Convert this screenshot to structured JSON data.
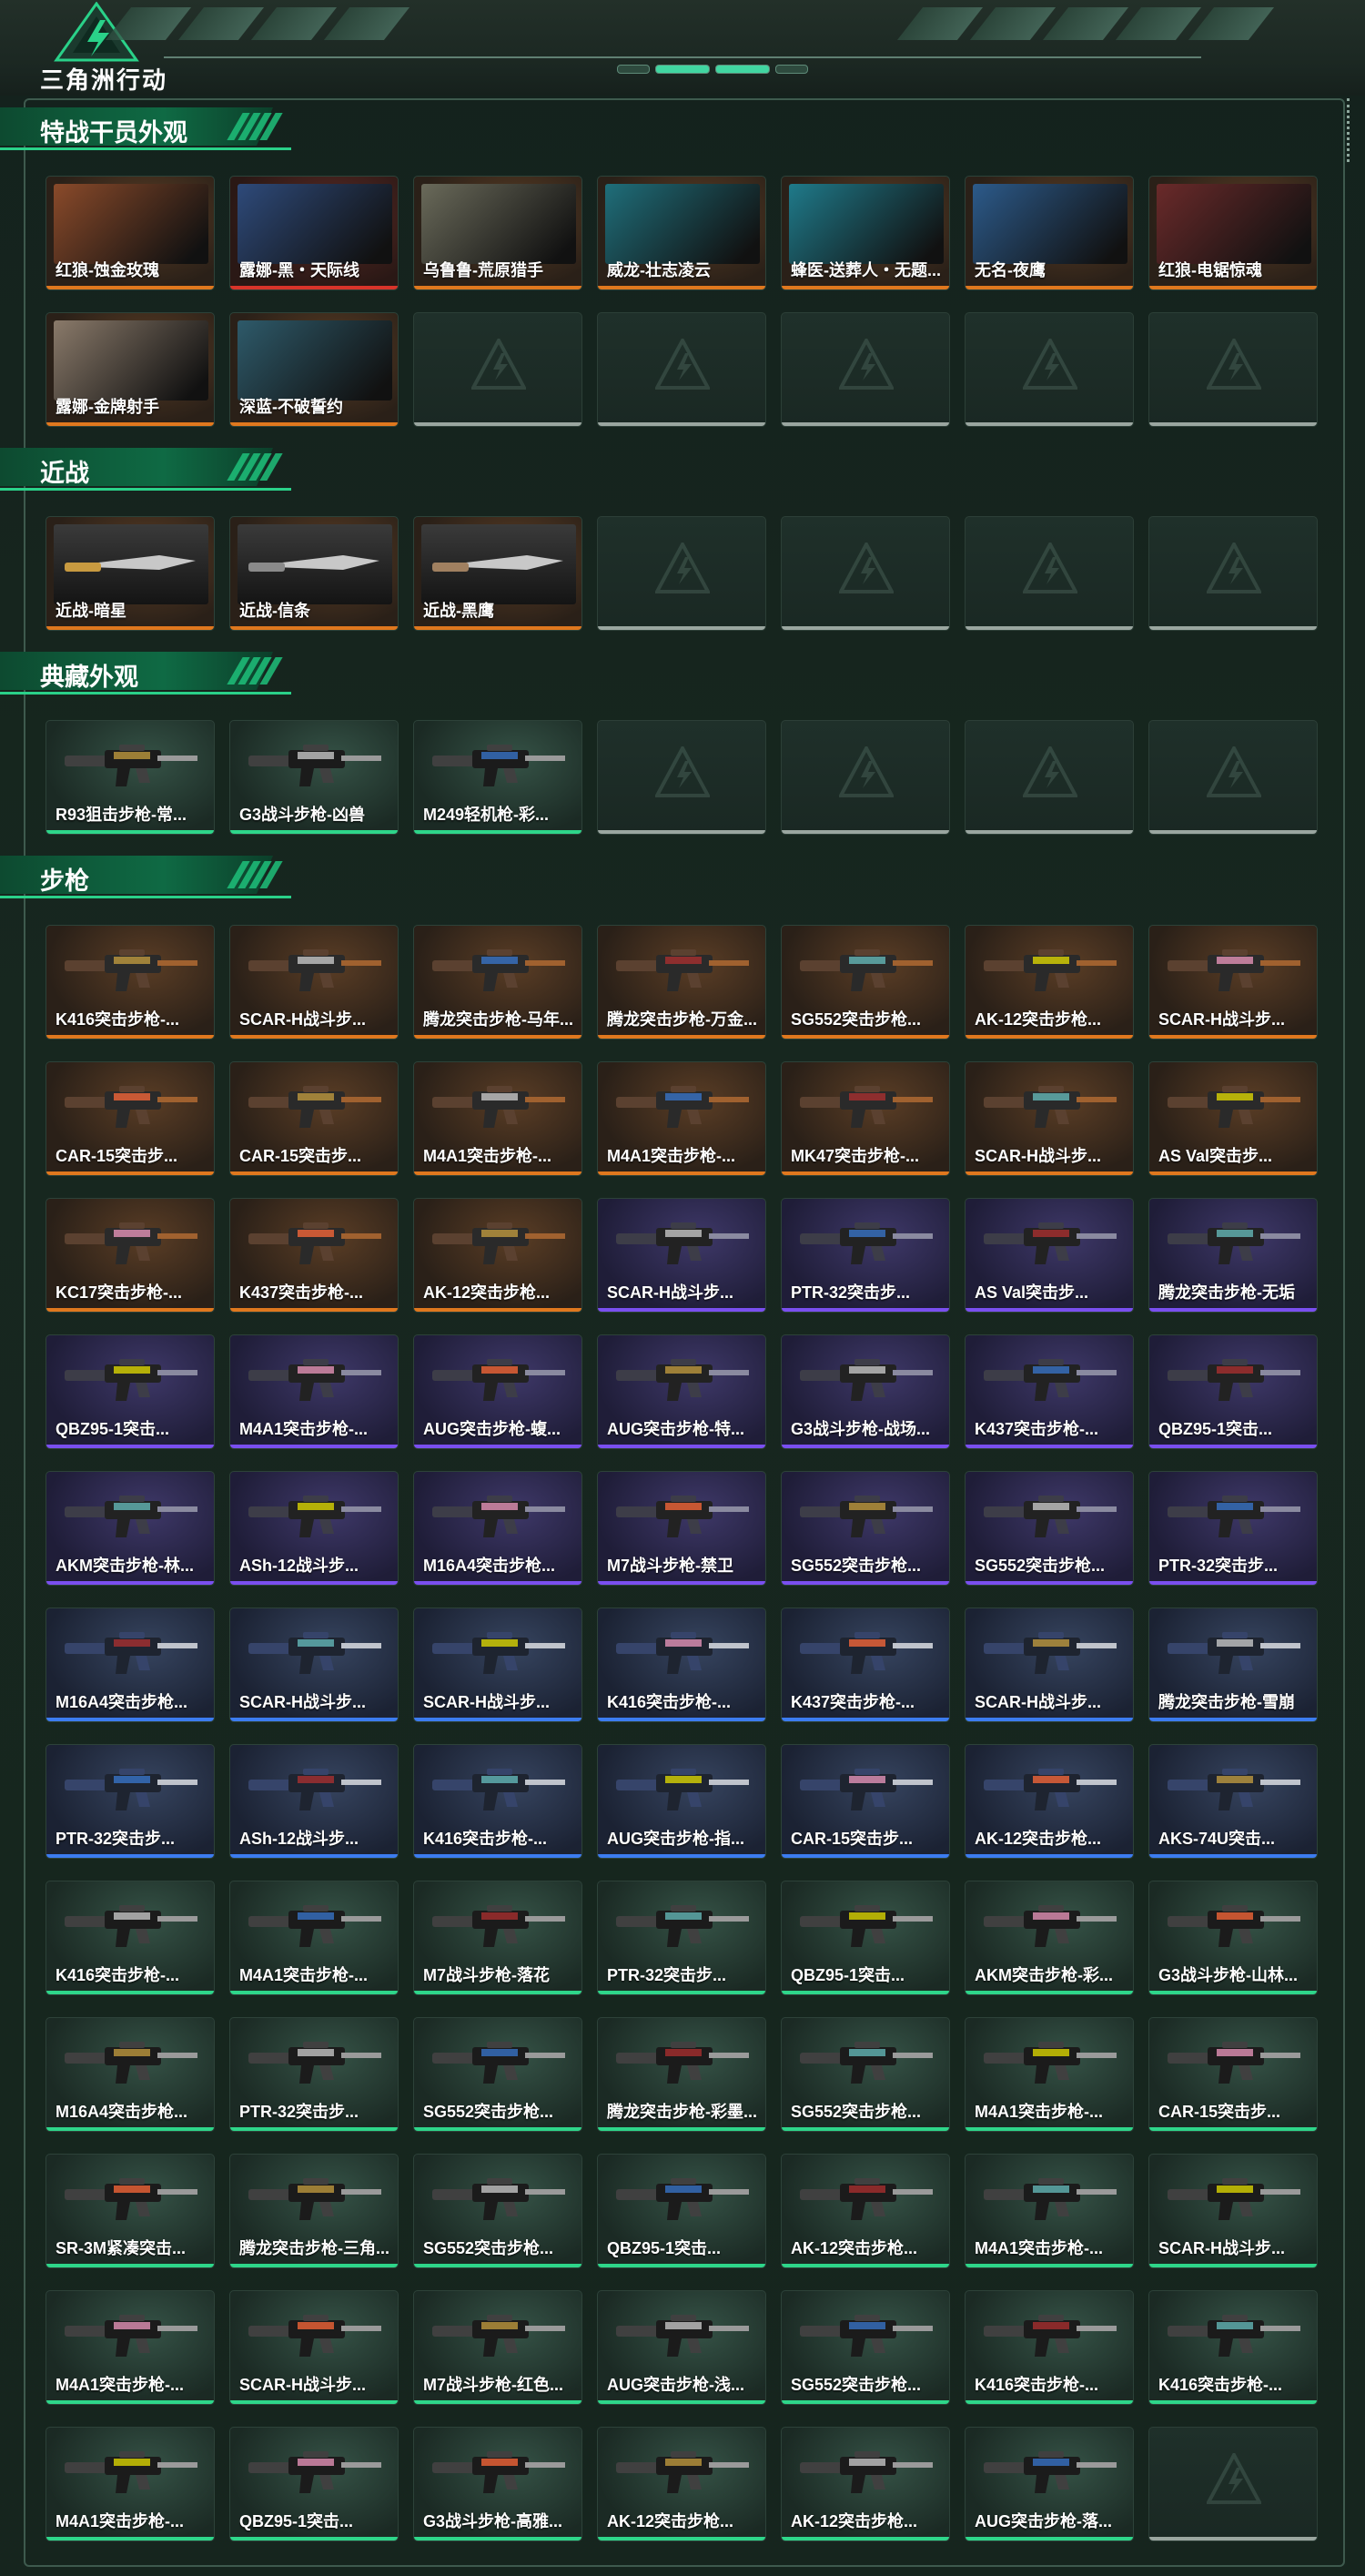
{
  "header": {
    "brand": "三角洲行动"
  },
  "colors": {
    "accent": "#2ad189",
    "orange": "#e0781e",
    "purple": "#7a4ff0",
    "blue": "#3c7cf0",
    "green": "#2ed68a",
    "red": "#d8342a"
  },
  "sections": [
    {
      "title": "特战干员外观",
      "items": [
        {
          "label": "红狼-蚀金玫瑰",
          "tier": "orange"
        },
        {
          "label": "露娜-黑・天际线",
          "tier": "red"
        },
        {
          "label": "乌鲁鲁-荒原猎手",
          "tier": "orange"
        },
        {
          "label": "威龙-壮志凌云",
          "tier": "orange"
        },
        {
          "label": "蜂医-送葬人・无题...",
          "tier": "orange"
        },
        {
          "label": "无名-夜鹰",
          "tier": "orange"
        },
        {
          "label": "红狼-电锯惊魂",
          "tier": "orange"
        },
        {
          "label": "露娜-金牌射手",
          "tier": "orange"
        },
        {
          "label": "深蓝-不破誓约",
          "tier": "orange"
        }
      ],
      "slots": 14
    },
    {
      "title": "近战",
      "items": [
        {
          "label": "近战-暗星",
          "tier": "orange"
        },
        {
          "label": "近战-信条",
          "tier": "orange"
        },
        {
          "label": "近战-黑鹰",
          "tier": "orange"
        }
      ],
      "slots": 7
    },
    {
      "title": "典藏外观",
      "items": [
        {
          "label": "R93狙击步枪-常...",
          "tier": "green"
        },
        {
          "label": "G3战斗步枪-凶兽",
          "tier": "green"
        },
        {
          "label": "M249轻机枪-彩...",
          "tier": "green"
        }
      ],
      "slots": 7
    },
    {
      "title": "步枪",
      "items": [
        {
          "label": "K416突击步枪-...",
          "tier": "orange"
        },
        {
          "label": "SCAR-H战斗步...",
          "tier": "orange"
        },
        {
          "label": "腾龙突击步枪-马年...",
          "tier": "orange"
        },
        {
          "label": "腾龙突击步枪-万金...",
          "tier": "orange"
        },
        {
          "label": "SG552突击步枪...",
          "tier": "orange"
        },
        {
          "label": "AK-12突击步枪...",
          "tier": "orange"
        },
        {
          "label": "SCAR-H战斗步...",
          "tier": "orange"
        },
        {
          "label": "CAR-15突击步...",
          "tier": "orange"
        },
        {
          "label": "CAR-15突击步...",
          "tier": "orange"
        },
        {
          "label": "M4A1突击步枪-...",
          "tier": "orange"
        },
        {
          "label": "M4A1突击步枪-...",
          "tier": "orange"
        },
        {
          "label": "MK47突击步枪-...",
          "tier": "orange"
        },
        {
          "label": "SCAR-H战斗步...",
          "tier": "orange"
        },
        {
          "label": "AS Val突击步...",
          "tier": "orange"
        },
        {
          "label": "KC17突击步枪-...",
          "tier": "orange"
        },
        {
          "label": "K437突击步枪-...",
          "tier": "orange"
        },
        {
          "label": "AK-12突击步枪...",
          "tier": "orange"
        },
        {
          "label": "SCAR-H战斗步...",
          "tier": "purple"
        },
        {
          "label": "PTR-32突击步...",
          "tier": "purple"
        },
        {
          "label": "AS Val突击步...",
          "tier": "purple"
        },
        {
          "label": "腾龙突击步枪-无垢",
          "tier": "purple"
        },
        {
          "label": "QBZ95-1突击...",
          "tier": "purple"
        },
        {
          "label": "M4A1突击步枪-...",
          "tier": "purple"
        },
        {
          "label": "AUG突击步枪-蝮...",
          "tier": "purple"
        },
        {
          "label": "AUG突击步枪-特...",
          "tier": "purple"
        },
        {
          "label": "G3战斗步枪-战场...",
          "tier": "purple"
        },
        {
          "label": "K437突击步枪-...",
          "tier": "purple"
        },
        {
          "label": "QBZ95-1突击...",
          "tier": "purple"
        },
        {
          "label": "AKM突击步枪-林...",
          "tier": "purple"
        },
        {
          "label": "ASh-12战斗步...",
          "tier": "purple"
        },
        {
          "label": "M16A4突击步枪...",
          "tier": "purple"
        },
        {
          "label": "M7战斗步枪-禁卫",
          "tier": "purple"
        },
        {
          "label": "SG552突击步枪...",
          "tier": "purple"
        },
        {
          "label": "SG552突击步枪...",
          "tier": "purple"
        },
        {
          "label": "PTR-32突击步...",
          "tier": "purple"
        },
        {
          "label": "M16A4突击步枪...",
          "tier": "blue"
        },
        {
          "label": "SCAR-H战斗步...",
          "tier": "blue"
        },
        {
          "label": "SCAR-H战斗步...",
          "tier": "blue"
        },
        {
          "label": "K416突击步枪-...",
          "tier": "blue"
        },
        {
          "label": "K437突击步枪-...",
          "tier": "blue"
        },
        {
          "label": "SCAR-H战斗步...",
          "tier": "blue"
        },
        {
          "label": "腾龙突击步枪-雪崩",
          "tier": "blue"
        },
        {
          "label": "PTR-32突击步...",
          "tier": "blue"
        },
        {
          "label": "ASh-12战斗步...",
          "tier": "blue"
        },
        {
          "label": "K416突击步枪-...",
          "tier": "blue"
        },
        {
          "label": "AUG突击步枪-指...",
          "tier": "blue"
        },
        {
          "label": "CAR-15突击步...",
          "tier": "blue"
        },
        {
          "label": "AK-12突击步枪...",
          "tier": "blue"
        },
        {
          "label": "AKS-74U突击...",
          "tier": "blue"
        },
        {
          "label": "K416突击步枪-...",
          "tier": "green"
        },
        {
          "label": "M4A1突击步枪-...",
          "tier": "green"
        },
        {
          "label": "M7战斗步枪-落花",
          "tier": "green"
        },
        {
          "label": "PTR-32突击步...",
          "tier": "green"
        },
        {
          "label": "QBZ95-1突击...",
          "tier": "green"
        },
        {
          "label": "AKM突击步枪-彩...",
          "tier": "green"
        },
        {
          "label": "G3战斗步枪-山林...",
          "tier": "green"
        },
        {
          "label": "M16A4突击步枪...",
          "tier": "green"
        },
        {
          "label": "PTR-32突击步...",
          "tier": "green"
        },
        {
          "label": "SG552突击步枪...",
          "tier": "green"
        },
        {
          "label": "腾龙突击步枪-彩墨...",
          "tier": "green"
        },
        {
          "label": "SG552突击步枪...",
          "tier": "green"
        },
        {
          "label": "M4A1突击步枪-...",
          "tier": "green"
        },
        {
          "label": "CAR-15突击步...",
          "tier": "green"
        },
        {
          "label": "SR-3M紧凑突击...",
          "tier": "green"
        },
        {
          "label": "腾龙突击步枪-三角...",
          "tier": "green"
        },
        {
          "label": "SG552突击步枪...",
          "tier": "green"
        },
        {
          "label": "QBZ95-1突击...",
          "tier": "green"
        },
        {
          "label": "AK-12突击步枪...",
          "tier": "green"
        },
        {
          "label": "M4A1突击步枪-...",
          "tier": "green"
        },
        {
          "label": "SCAR-H战斗步...",
          "tier": "green"
        },
        {
          "label": "M4A1突击步枪-...",
          "tier": "green"
        },
        {
          "label": "SCAR-H战斗步...",
          "tier": "green"
        },
        {
          "label": "M7战斗步枪-红色...",
          "tier": "green"
        },
        {
          "label": "AUG突击步枪-浅...",
          "tier": "green"
        },
        {
          "label": "SG552突击步枪...",
          "tier": "green"
        },
        {
          "label": "K416突击步枪-...",
          "tier": "green"
        },
        {
          "label": "K416突击步枪-...",
          "tier": "green"
        },
        {
          "label": "M4A1突击步枪-...",
          "tier": "green"
        },
        {
          "label": "QBZ95-1突击...",
          "tier": "green"
        },
        {
          "label": "G3战斗步枪-高雅...",
          "tier": "green"
        },
        {
          "label": "AK-12突击步枪...",
          "tier": "green"
        },
        {
          "label": "AK-12突击步枪...",
          "tier": "green"
        },
        {
          "label": "AUG突击步枪-落...",
          "tier": "green"
        }
      ],
      "slots": 84
    }
  ]
}
